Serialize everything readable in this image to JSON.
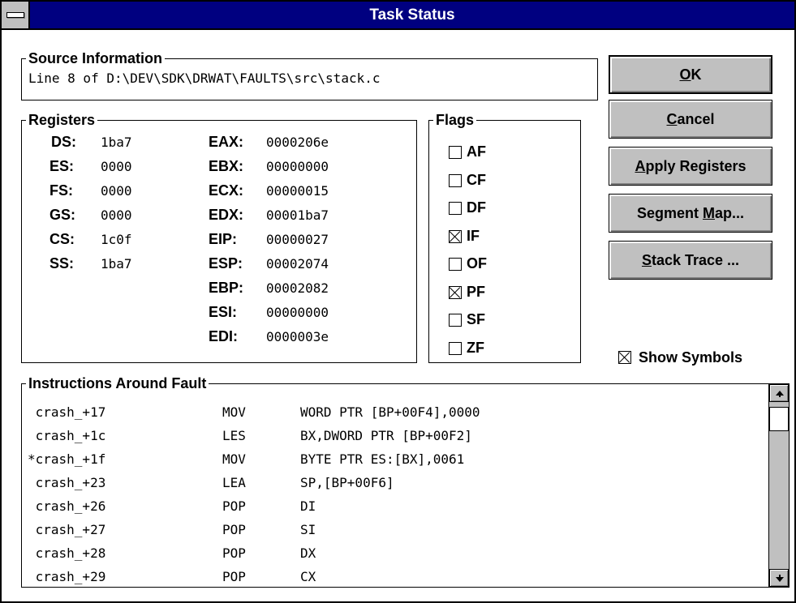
{
  "window": {
    "title": "Task Status"
  },
  "source": {
    "label": "Source Information",
    "text": "Line 8 of D:\\DEV\\SDK\\DRWAT\\FAULTS\\src\\stack.c"
  },
  "registers": {
    "label": "Registers",
    "segment": [
      {
        "name": "DS:",
        "value": "1ba7"
      },
      {
        "name": "ES:",
        "value": "0000"
      },
      {
        "name": "FS:",
        "value": "0000"
      },
      {
        "name": "GS:",
        "value": "0000"
      },
      {
        "name": "CS:",
        "value": "1c0f"
      },
      {
        "name": "SS:",
        "value": "1ba7"
      }
    ],
    "general": [
      {
        "name": "EAX:",
        "value": "0000206e"
      },
      {
        "name": "EBX:",
        "value": "00000000"
      },
      {
        "name": "ECX:",
        "value": "00000015"
      },
      {
        "name": "EDX:",
        "value": "00001ba7"
      },
      {
        "name": "EIP:",
        "value": "00000027"
      },
      {
        "name": "ESP:",
        "value": "00002074"
      },
      {
        "name": "EBP:",
        "value": "00002082"
      },
      {
        "name": "ESI:",
        "value": "00000000"
      },
      {
        "name": "EDI:",
        "value": "0000003e"
      }
    ]
  },
  "flags": {
    "label": "Flags",
    "items": [
      {
        "name": "AF",
        "checked": false
      },
      {
        "name": "CF",
        "checked": false
      },
      {
        "name": "DF",
        "checked": false
      },
      {
        "name": "IF",
        "checked": true
      },
      {
        "name": "OF",
        "checked": false
      },
      {
        "name": "PF",
        "checked": true
      },
      {
        "name": "SF",
        "checked": false
      },
      {
        "name": "ZF",
        "checked": false
      }
    ]
  },
  "buttons": {
    "ok": {
      "mnemonic": "O",
      "rest": "K"
    },
    "cancel": {
      "mnemonic": "C",
      "rest": "ancel"
    },
    "apply": {
      "mnemonic": "A",
      "rest": "pply Registers"
    },
    "segment_map": {
      "pre": "Segment ",
      "mnemonic": "M",
      "rest": "ap..."
    },
    "stack_trace": {
      "mnemonic": "S",
      "rest": "tack Trace ..."
    }
  },
  "show_symbols": {
    "label": "Show Symbols",
    "checked": true
  },
  "instructions": {
    "label": "Instructions Around Fault",
    "rows": [
      {
        "address": " crash_+17",
        "opcode": "MOV",
        "operand": "WORD PTR [BP+00F4],0000"
      },
      {
        "address": " crash_+1c",
        "opcode": "LES",
        "operand": "BX,DWORD PTR [BP+00F2]"
      },
      {
        "address": "*crash_+1f",
        "opcode": "MOV",
        "operand": "BYTE PTR ES:[BX],0061"
      },
      {
        "address": " crash_+23",
        "opcode": "LEA",
        "operand": "SP,[BP+00F6]"
      },
      {
        "address": " crash_+26",
        "opcode": "POP",
        "operand": "DI"
      },
      {
        "address": " crash_+27",
        "opcode": "POP",
        "operand": "SI"
      },
      {
        "address": " crash_+28",
        "opcode": "POP",
        "operand": "DX"
      },
      {
        "address": " crash_+29",
        "opcode": "POP",
        "operand": "CX"
      }
    ]
  },
  "colors": {
    "titlebar": "#000080",
    "button_face": "#c0c0c0"
  }
}
